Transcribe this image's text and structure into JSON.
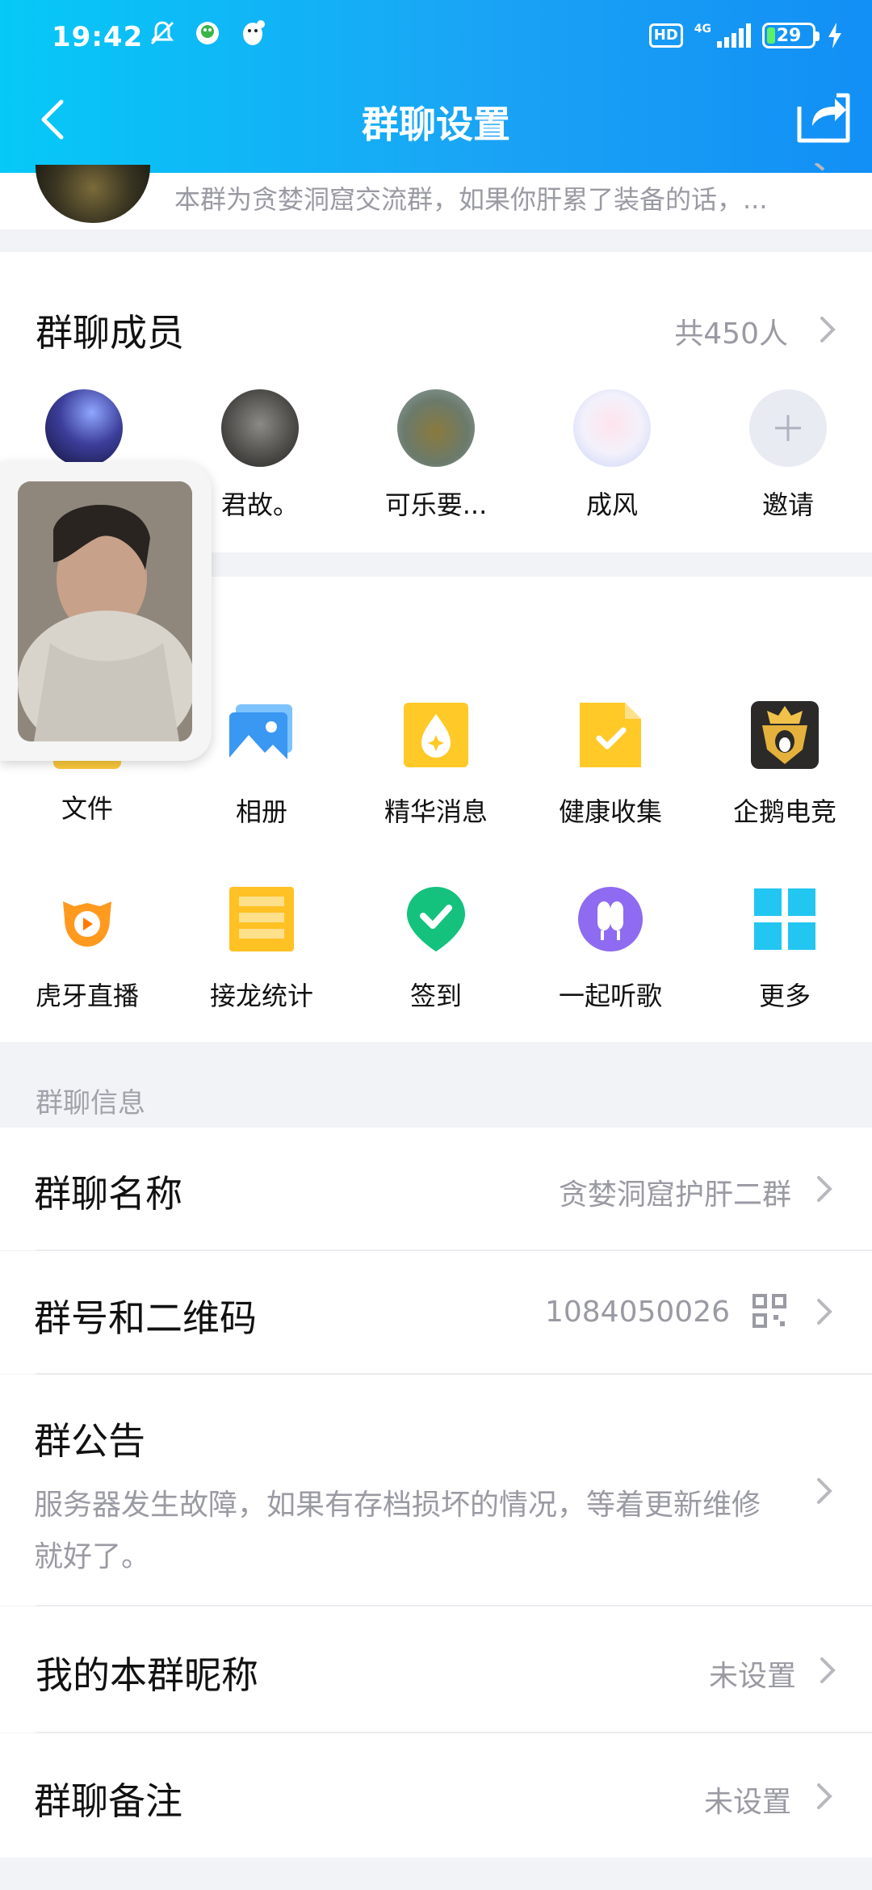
{
  "status_bar": {
    "time": "19:42",
    "hd": "HD",
    "network": "4G",
    "battery": "29"
  },
  "header": {
    "title": "群聊设置"
  },
  "group": {
    "description": "本群为贪婪洞窟交流群，如果你肝累了装备的话，..."
  },
  "members": {
    "title": "群聊成员",
    "count": "共450人",
    "items": [
      {
        "name": ""
      },
      {
        "name": "君故。"
      },
      {
        "name": "可乐要..."
      },
      {
        "name": "成风"
      },
      {
        "name": "邀请"
      }
    ]
  },
  "apps": {
    "row1": [
      {
        "label": "文件",
        "icon": "file-icon"
      },
      {
        "label": "相册",
        "icon": "album-icon"
      },
      {
        "label": "精华消息",
        "icon": "essence-icon"
      },
      {
        "label": "健康收集",
        "icon": "health-collect-icon"
      },
      {
        "label": "企鹅电竞",
        "icon": "penguin-esports-icon"
      }
    ],
    "row2": [
      {
        "label": "虎牙直播",
        "icon": "huya-icon"
      },
      {
        "label": "接龙统计",
        "icon": "solitaire-icon"
      },
      {
        "label": "签到",
        "icon": "checkin-icon"
      },
      {
        "label": "一起听歌",
        "icon": "music-icon"
      },
      {
        "label": "更多",
        "icon": "more-grid-icon"
      }
    ]
  },
  "info": {
    "section_label": "群聊信息",
    "name_label": "群聊名称",
    "name_value": "贪婪洞窟护肝二群",
    "number_label": "群号和二维码",
    "number_value": "1084050026",
    "notice_label": "群公告",
    "notice_line1": "服务器发生故障，如果有存档损坏的情况，等着更新维修",
    "notice_line2": "就好了。",
    "nickname_label": "我的本群昵称",
    "nickname_value": "未设置",
    "remark_label": "群聊备注",
    "remark_value": "未设置"
  },
  "colors": {
    "header_start": "#06c9f7",
    "header_end": "#128ff5",
    "muted_text": "#9a9aa3"
  }
}
